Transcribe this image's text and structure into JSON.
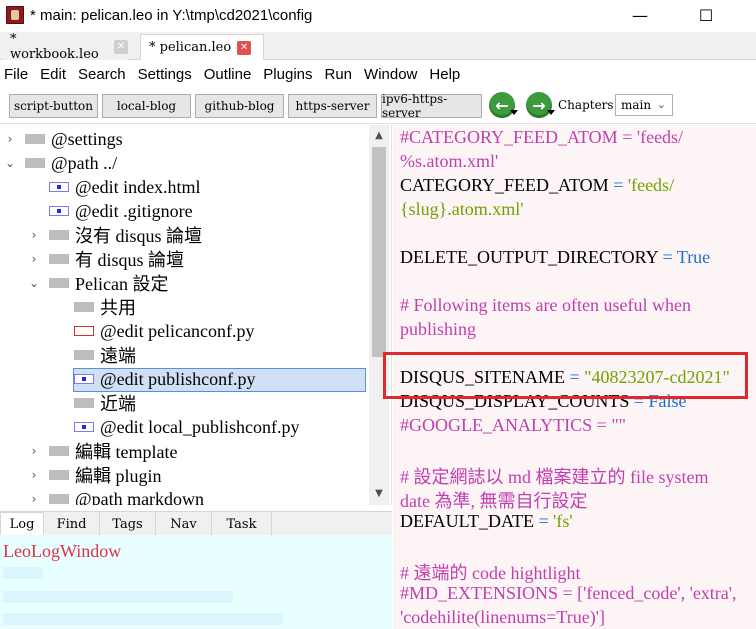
{
  "window": {
    "title": "* main: pelican.leo in Y:\\tmp\\cd2021\\config",
    "minimize_glyph": "—",
    "maximize_glyph": "☐"
  },
  "tabs": [
    {
      "label": "* workbook.leo",
      "close": "✕"
    },
    {
      "label": "* pelican.leo",
      "close": "✕"
    }
  ],
  "menu": [
    "File",
    "Edit",
    "Search",
    "Settings",
    "Outline",
    "Plugins",
    "Run",
    "Window",
    "Help"
  ],
  "toolbar": {
    "buttons": [
      "script-button",
      "local-blog",
      "github-blog",
      "https-server",
      "ipv6-https-server"
    ],
    "back_glyph": "←",
    "forward_glyph": "→",
    "chapters_label": "Chapters:",
    "chapters_value": "main"
  },
  "outline": {
    "nodes": [
      {
        "caret": "›",
        "label": "@settings"
      },
      {
        "caret": "⌄",
        "label": "@path ../"
      },
      {
        "caret": "",
        "label": "@edit index.html"
      },
      {
        "caret": "",
        "label": "@edit .gitignore"
      },
      {
        "caret": "›",
        "label": "沒有 disqus 論壇"
      },
      {
        "caret": "›",
        "label": "有 disqus 論壇"
      },
      {
        "caret": "⌄",
        "label": "Pelican 設定"
      },
      {
        "caret": "",
        "label": "共用"
      },
      {
        "caret": "",
        "label": "@edit pelicanconf.py"
      },
      {
        "caret": "",
        "label": "遠端"
      },
      {
        "caret": "",
        "label": "@edit publishconf.py"
      },
      {
        "caret": "",
        "label": "近端"
      },
      {
        "caret": "",
        "label": "@edit local_publishconf.py"
      },
      {
        "caret": "›",
        "label": "編輯 template"
      },
      {
        "caret": "›",
        "label": "編輯 plugin"
      },
      {
        "caret": "›",
        "label": "@path markdown"
      }
    ]
  },
  "log": {
    "tabs": [
      "Log",
      "Find",
      "Tags",
      "Nav",
      "Task"
    ],
    "title": "LeoLogWindow"
  },
  "body": {
    "lines": [
      [
        {
          "t": "#CATEGORY_FEED_ATOM = 'feeds/",
          "c": "comment"
        }
      ],
      [
        {
          "t": "%s.atom.xml'",
          "c": "comment"
        }
      ],
      [
        {
          "t": "CATEGORY_FEED_ATOM",
          "c": "name"
        },
        {
          "t": " = ",
          "c": "op"
        },
        {
          "t": "'feeds/",
          "c": "str"
        }
      ],
      [
        {
          "t": "{slug}.atom.xml'",
          "c": "str"
        }
      ],
      [],
      [
        {
          "t": "DELETE_OUTPUT_DIRECTORY",
          "c": "name"
        },
        {
          "t": " = ",
          "c": "op"
        },
        {
          "t": "True",
          "c": "kw"
        }
      ],
      [],
      [
        {
          "t": "# Following items are often useful when",
          "c": "comment"
        }
      ],
      [
        {
          "t": "publishing",
          "c": "comment"
        }
      ],
      [],
      [
        {
          "t": "DISQUS_SITENAME",
          "c": "name"
        },
        {
          "t": " = ",
          "c": "op"
        },
        {
          "t": "\"40823207-cd2021\"",
          "c": "str"
        }
      ],
      [
        {
          "t": "DISQUS_DISPLAY_COUNTS",
          "c": "name"
        },
        {
          "t": " = ",
          "c": "op"
        },
        {
          "t": "False",
          "c": "kw"
        }
      ],
      [
        {
          "t": "#GOOGLE_ANALYTICS = \"\"",
          "c": "comment"
        }
      ],
      [],
      [
        {
          "t": "# 設定網誌以 md 檔案建立的 file system",
          "c": "comment"
        }
      ],
      [
        {
          "t": "date 為準, 無需自行設定",
          "c": "comment"
        }
      ],
      [
        {
          "t": "DEFAULT_DATE",
          "c": "name"
        },
        {
          "t": " = ",
          "c": "op"
        },
        {
          "t": "'fs'",
          "c": "str"
        }
      ],
      [],
      [
        {
          "t": "# 遠端的 code hightlight",
          "c": "comment"
        }
      ],
      [
        {
          "t": "#MD_EXTENSIONS = ['fenced_code', 'extra',",
          "c": "comment"
        }
      ],
      [
        {
          "t": "'codehilite(linenums=True)']",
          "c": "comment"
        }
      ]
    ]
  },
  "colors": {
    "comment": "#c03eb0",
    "string": "#71a100",
    "operator": "#1a6fd0",
    "highlight_box": "#e0282e",
    "log_title": "#e0304a"
  }
}
